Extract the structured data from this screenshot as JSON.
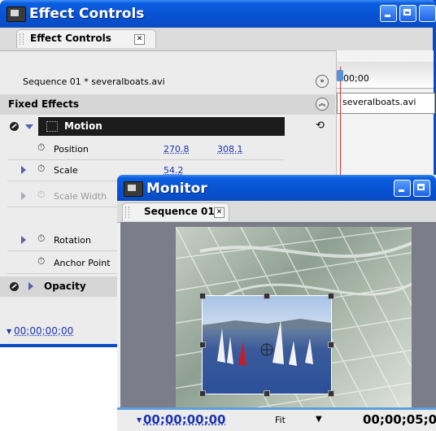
{
  "effect_window": {
    "title": "Effect Controls",
    "tab_label": "Effect Controls",
    "sequence_label": "Sequence 01 * severalboats.avi",
    "fixed_effects": "Fixed Effects",
    "timeline_time": "00;00",
    "clip_name": "severalboats.avi",
    "motion_label": "Motion",
    "opacity_label": "Opacity",
    "current_time": "00;00;00;00",
    "rows": {
      "position": {
        "label": "Position",
        "v1": "270.8",
        "v2": "308.1"
      },
      "scale": {
        "label": "Scale",
        "v1": "54.2"
      },
      "scale_width": {
        "label": "Scale Width"
      },
      "rotation": {
        "label": "Rotation"
      },
      "anchor": {
        "label": "Anchor Point"
      }
    }
  },
  "monitor_window": {
    "title": "Monitor",
    "tab_label": "Sequence 01",
    "current_time": "00;00;00;00",
    "zoom": "Fit",
    "duration": "00;00;05;0"
  },
  "colors": {
    "xp_blue": "#0a4bc4",
    "time_blue": "#1a33b0",
    "playhead": "#e03030"
  }
}
